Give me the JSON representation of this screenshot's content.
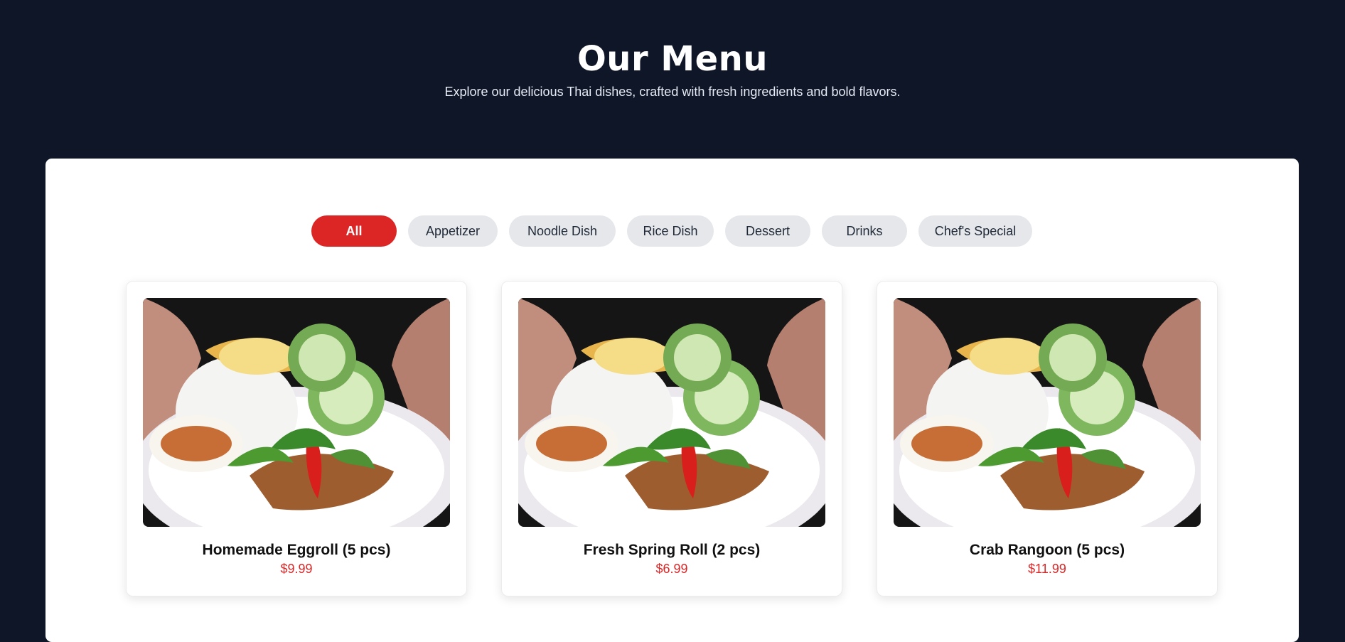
{
  "header": {
    "title": "Our Menu",
    "subtitle": "Explore our delicious Thai dishes, crafted with fresh ingredients and bold flavors."
  },
  "filters": [
    {
      "label": "All",
      "active": true
    },
    {
      "label": "Appetizer",
      "active": false
    },
    {
      "label": "Noodle Dish",
      "active": false
    },
    {
      "label": "Rice Dish",
      "active": false
    },
    {
      "label": "Dessert",
      "active": false
    },
    {
      "label": "Drinks",
      "active": false
    },
    {
      "label": "Chef's Special",
      "active": false
    }
  ],
  "items": [
    {
      "name": "Homemade Eggroll (5 pcs)",
      "price": "$9.99",
      "image": "thai-rice-dish-photo"
    },
    {
      "name": "Fresh Spring Roll (2 pcs)",
      "price": "$6.99",
      "image": "thai-rice-dish-photo"
    },
    {
      "name": "Crab Rangoon (5 pcs)",
      "price": "$11.99",
      "image": "thai-rice-dish-photo"
    }
  ],
  "colors": {
    "background": "#0e1628",
    "panel": "#ffffff",
    "accent": "#dc2626",
    "pill": "#e5e7eb",
    "text": "#1f2937"
  }
}
